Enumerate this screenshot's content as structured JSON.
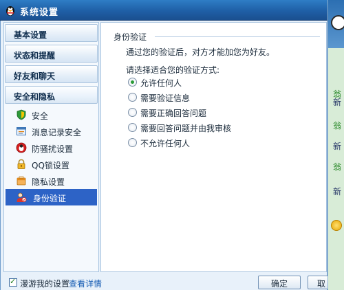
{
  "window": {
    "title": "系统设置"
  },
  "sidebar": {
    "categories": [
      {
        "label": "基本设置"
      },
      {
        "label": "状态和提醒"
      },
      {
        "label": "好友和聊天"
      },
      {
        "label": "安全和隐私"
      }
    ],
    "items": [
      {
        "label": "安全",
        "icon": "shield-icon"
      },
      {
        "label": "消息记录安全",
        "icon": "message-record-icon"
      },
      {
        "label": "防骚扰设置",
        "icon": "anti-harass-icon"
      },
      {
        "label": "QQ锁设置",
        "icon": "lock-icon"
      },
      {
        "label": "隐私设置",
        "icon": "privacy-icon"
      },
      {
        "label": "身份验证",
        "icon": "identity-icon",
        "selected": true
      }
    ]
  },
  "content": {
    "group_title": "身份验证",
    "description": "通过您的验证后，对方才能加您为好友。",
    "prompt": "请选择适合您的验证方式:",
    "options": [
      {
        "label": "允许任何人",
        "selected": true
      },
      {
        "label": "需要验证信息",
        "selected": false
      },
      {
        "label": "需要正确回答问题",
        "selected": false
      },
      {
        "label": "需要回答问题并由我审核",
        "selected": false
      },
      {
        "label": "不允许任何人",
        "selected": false
      }
    ]
  },
  "footer": {
    "roam_label": "漫游我的设置",
    "roam_checked": true,
    "details_link": "查看详情",
    "ok_label": "确定",
    "cancel_label": "取"
  },
  "background": {
    "lines": [
      "翁",
      "新",
      "翁",
      "新",
      "翁",
      "新"
    ]
  },
  "colors": {
    "titlebar": "#1f5fa6",
    "selected_item": "#2d63c6",
    "radio_dot": "#2a9b36",
    "link": "#1a5fb4"
  }
}
